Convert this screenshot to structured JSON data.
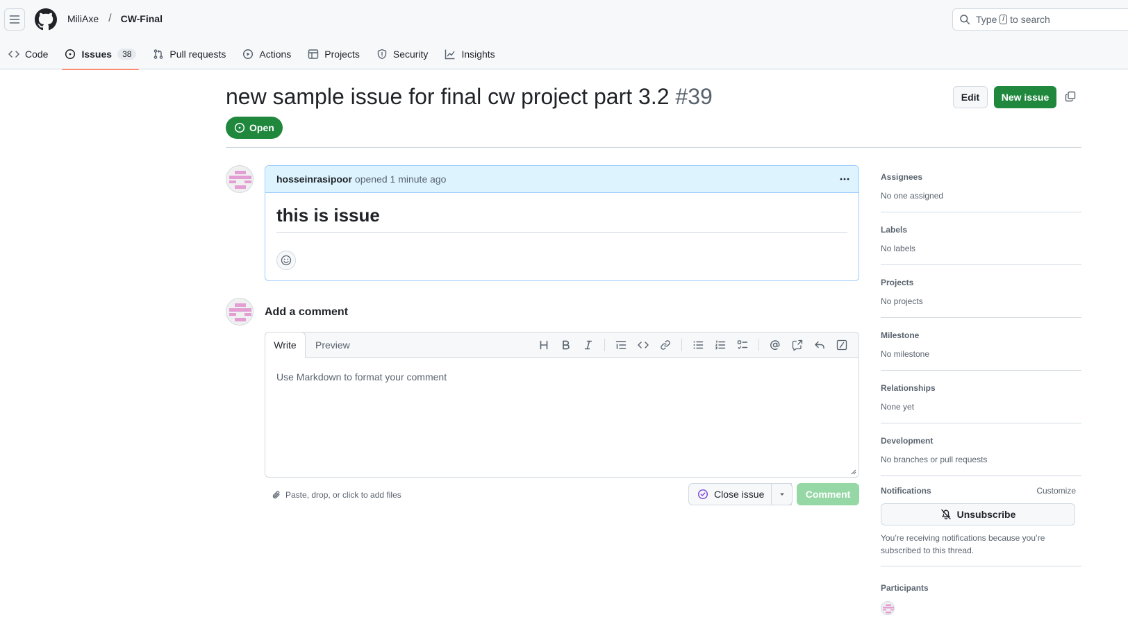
{
  "header": {
    "owner": "MiliAxe",
    "separator": "/",
    "repo": "CW-Final",
    "search": {
      "prefix": "Type",
      "key": "/",
      "suffix": "to search"
    }
  },
  "tabs": [
    {
      "label": "Code",
      "icon": "code-icon"
    },
    {
      "label": "Issues",
      "icon": "issue-opened-icon",
      "count": "38",
      "active": true
    },
    {
      "label": "Pull requests",
      "icon": "git-pull-request-icon"
    },
    {
      "label": "Actions",
      "icon": "play-icon"
    },
    {
      "label": "Projects",
      "icon": "table-icon"
    },
    {
      "label": "Security",
      "icon": "shield-icon"
    },
    {
      "label": "Insights",
      "icon": "graph-icon"
    }
  ],
  "issue": {
    "title": "new sample issue for final cw project part 3.2",
    "number": "#39",
    "state": "Open",
    "edit_label": "Edit",
    "new_issue_label": "New issue"
  },
  "comment": {
    "author": "hosseinrasipoor",
    "action": "opened 1 minute ago",
    "body_heading": "this is issue"
  },
  "composer": {
    "title": "Add a comment",
    "tab_write": "Write",
    "tab_preview": "Preview",
    "placeholder": "Use Markdown to format your comment",
    "attach_hint": "Paste, drop, or click to add files",
    "close_issue_label": "Close issue",
    "comment_label": "Comment",
    "toolbar_icons": [
      "heading-icon",
      "bold-icon",
      "italic-icon",
      "quote-icon",
      "code-icon",
      "link-icon",
      "list-unordered-icon",
      "list-ordered-icon",
      "tasklist-icon",
      "mention-icon",
      "cross-reference-icon",
      "reply-icon",
      "slash-command-icon"
    ]
  },
  "sidebar": {
    "assignees": {
      "heading": "Assignees",
      "value": "No one assigned"
    },
    "labels": {
      "heading": "Labels",
      "value": "No labels"
    },
    "projects": {
      "heading": "Projects",
      "value": "No projects"
    },
    "milestone": {
      "heading": "Milestone",
      "value": "No milestone"
    },
    "relationships": {
      "heading": "Relationships",
      "value": "None yet"
    },
    "development": {
      "heading": "Development",
      "value": "No branches or pull requests"
    },
    "notifications": {
      "heading": "Notifications",
      "customize": "Customize",
      "button": "Unsubscribe",
      "note": "You’re receiving notifications because you’re subscribed to this thread."
    },
    "participants": {
      "heading": "Participants"
    }
  },
  "colors": {
    "primary_green": "#1f883d",
    "disabled_green": "#95d8a6",
    "comment_header_bg": "#ddf4ff",
    "comment_border": "#9ecbff",
    "active_tab_underline": "#fd8c73",
    "avatar_pink": "#e39fd3"
  }
}
